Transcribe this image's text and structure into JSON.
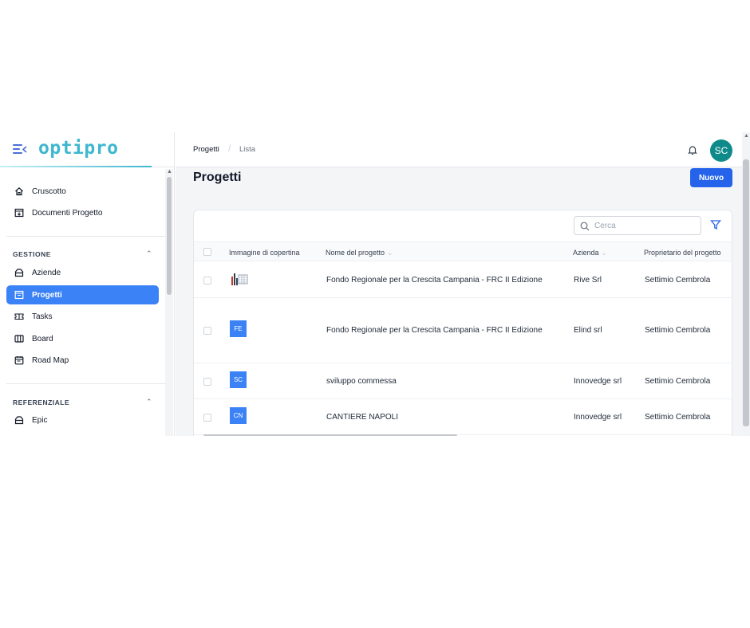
{
  "brand": {
    "logo": "optipro"
  },
  "sidebar": {
    "items_top": [
      {
        "label": "Cruscotto",
        "icon": "home-icon"
      },
      {
        "label": "Documenti Progetto",
        "icon": "document-tray-icon"
      }
    ],
    "section_gestione": "GESTIONE",
    "items_gestione": [
      {
        "label": "Aziende",
        "icon": "building-icon"
      },
      {
        "label": "Progetti",
        "icon": "project-icon",
        "active": true
      },
      {
        "label": "Tasks",
        "icon": "tasks-icon"
      },
      {
        "label": "Board",
        "icon": "board-icon"
      },
      {
        "label": "Road Map",
        "icon": "calendar-icon"
      }
    ],
    "section_referenziale": "REFERENZIALE",
    "items_referenziale": [
      {
        "label": "Epic",
        "icon": "epic-icon"
      }
    ]
  },
  "topbar": {
    "breadcrumb": [
      "Progetti",
      "Lista"
    ],
    "breadcrumb_sep": "/",
    "avatar_initials": "SC"
  },
  "main": {
    "title": "Progetti",
    "new_button": "Nuovo",
    "search_placeholder": "Cerca",
    "columns": [
      "Immagine di copertina",
      "Nome del progetto",
      "Azienda",
      "Proprietario del progetto"
    ],
    "sort_indicator": "⌄",
    "rows": [
      {
        "image": "thumbnail",
        "name": "Fondo Regionale per la Crescita Campania - FRC II Edizione",
        "company": "Rive Srl",
        "owner": "Settimio Cembrola"
      },
      {
        "image": "FE",
        "name": "Fondo Regionale per la Crescita Campania - FRC II Edizione",
        "company": "Elind srl",
        "owner": "Settimio Cembrola"
      },
      {
        "image": "SC",
        "name": "sviluppo commessa",
        "company": "Innovedge srl",
        "owner": "Settimio Cembrola"
      },
      {
        "image": "CN",
        "name": "CANTIERE NAPOLI",
        "company": "Innovedge srl",
        "owner": "Settimio Cembrola"
      }
    ]
  },
  "colors": {
    "accent": "#3b82f6",
    "primary_button": "#2563eb",
    "logo": "#3db7cf",
    "avatar": "#0f8a8a"
  }
}
